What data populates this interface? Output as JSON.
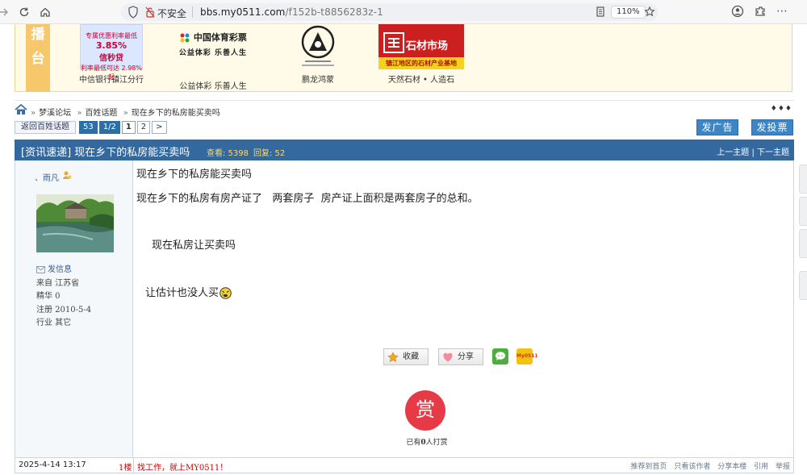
{
  "browser": {
    "insecure_label": "不安全",
    "url_host": "bbs.my0511.com",
    "url_path": "/f152b-t8856283z-1",
    "zoom": "110%"
  },
  "banner": {
    "side_tag": [
      "播",
      "台"
    ],
    "ads": [
      {
        "caption": "中信银行镇江分行",
        "logo_lines": [
          "专属优惠利率最低",
          "3.85%",
          "信秒贷",
          "利率最低可达 2.98%起"
        ]
      },
      {
        "caption": "公益体彩 乐善人生",
        "logo_lines": [
          "中国体育彩票",
          "公益体彩 乐善人生"
        ]
      },
      {
        "caption": "鹏龙鸿蒙"
      },
      {
        "caption": "天然石材 • 人造石",
        "logo_lines": [
          "石材市场",
          "镇江地区的石材产业基地"
        ]
      }
    ]
  },
  "breadcrumb": {
    "items": [
      "梦溪论坛",
      "百姓话题",
      "现在乡下的私房能买卖吗"
    ],
    "toggle": "♦♦♦"
  },
  "actions": {
    "back_label": "返回百姓话题",
    "pager": {
      "total": "53",
      "pages": "1/2",
      "current": "1",
      "next_page": "2",
      "next": ">"
    },
    "ad_label": "发广告",
    "vote_label": "发投票"
  },
  "thread": {
    "title": "[资讯速递] 现在乡下的私房能买卖吗",
    "views": "查看: 5398",
    "replies": "回复: 52",
    "prev_next": "上一主题 | 下一主题"
  },
  "author": {
    "name": "、雨凡",
    "send_msg": "发信息",
    "from": "来自 江苏省",
    "essence": "精华 0",
    "registered": "注册 2010-5-4",
    "industry": "行业 其它"
  },
  "post": {
    "title": "现在乡下的私房能买卖吗",
    "line1": "现在乡下的私房有房产证了   两套房子  房产证上面积是两套房子的总和。",
    "line2": "现在私房让买卖吗",
    "line3": "让估计也没人买",
    "fav_label": "收藏",
    "share_label": "分享",
    "my0511_label": "My0511",
    "reward_char": "赏",
    "reward_prefix": "已有",
    "reward_count": "0",
    "reward_suffix": "人打赏",
    "date": "2025-4-14 13:17",
    "floor": "1楼",
    "signature": "找工作，就上MY0511！",
    "tools": [
      "推荐到首页",
      "只看该作者",
      "分享本楼",
      "引用",
      "举报"
    ]
  }
}
